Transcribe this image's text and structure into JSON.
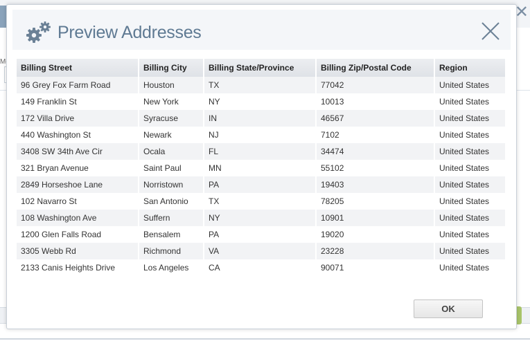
{
  "background": {
    "label_fragment": "Mc"
  },
  "dialog": {
    "title": "Preview Addresses",
    "icon": "gears-icon",
    "close_icon": "close-icon",
    "ok_label": "OK"
  },
  "table": {
    "columns": [
      "Billing Street",
      "Billing City",
      "Billing State/Province",
      "Billing Zip/Postal Code",
      "Region"
    ],
    "rows": [
      [
        "96 Grey Fox Farm Road",
        "Houston",
        "TX",
        "77042",
        "United States"
      ],
      [
        "149 Franklin St",
        "New York",
        "NY",
        "10013",
        "United States"
      ],
      [
        "172 Villa Drive",
        "Syracuse",
        "IN",
        "46567",
        "United States"
      ],
      [
        "440 Washington St",
        "Newark",
        "NJ",
        "7102",
        "United States"
      ],
      [
        "3408 SW 34th Ave Cir",
        "Ocala",
        "FL",
        "34474",
        "United States"
      ],
      [
        "321 Bryan Avenue",
        "Saint Paul",
        "MN",
        "55102",
        "United States"
      ],
      [
        "2849 Horseshoe Lane",
        "Norristown",
        "PA",
        "19403",
        "United States"
      ],
      [
        "102 Navarro St",
        "San Antonio",
        "TX",
        "78205",
        "United States"
      ],
      [
        "108 Washington Ave",
        "Suffern",
        "NY",
        "10901",
        "United States"
      ],
      [
        "1200 Glen Falls Road",
        "Bensalem",
        "PA",
        "19020",
        "United States"
      ],
      [
        "3305 Webb Rd",
        "Richmond",
        "VA",
        "23228",
        "United States"
      ],
      [
        "2133 Canis Heights Drive",
        "Los Angeles",
        "CA",
        "90071",
        "United States"
      ]
    ]
  }
}
